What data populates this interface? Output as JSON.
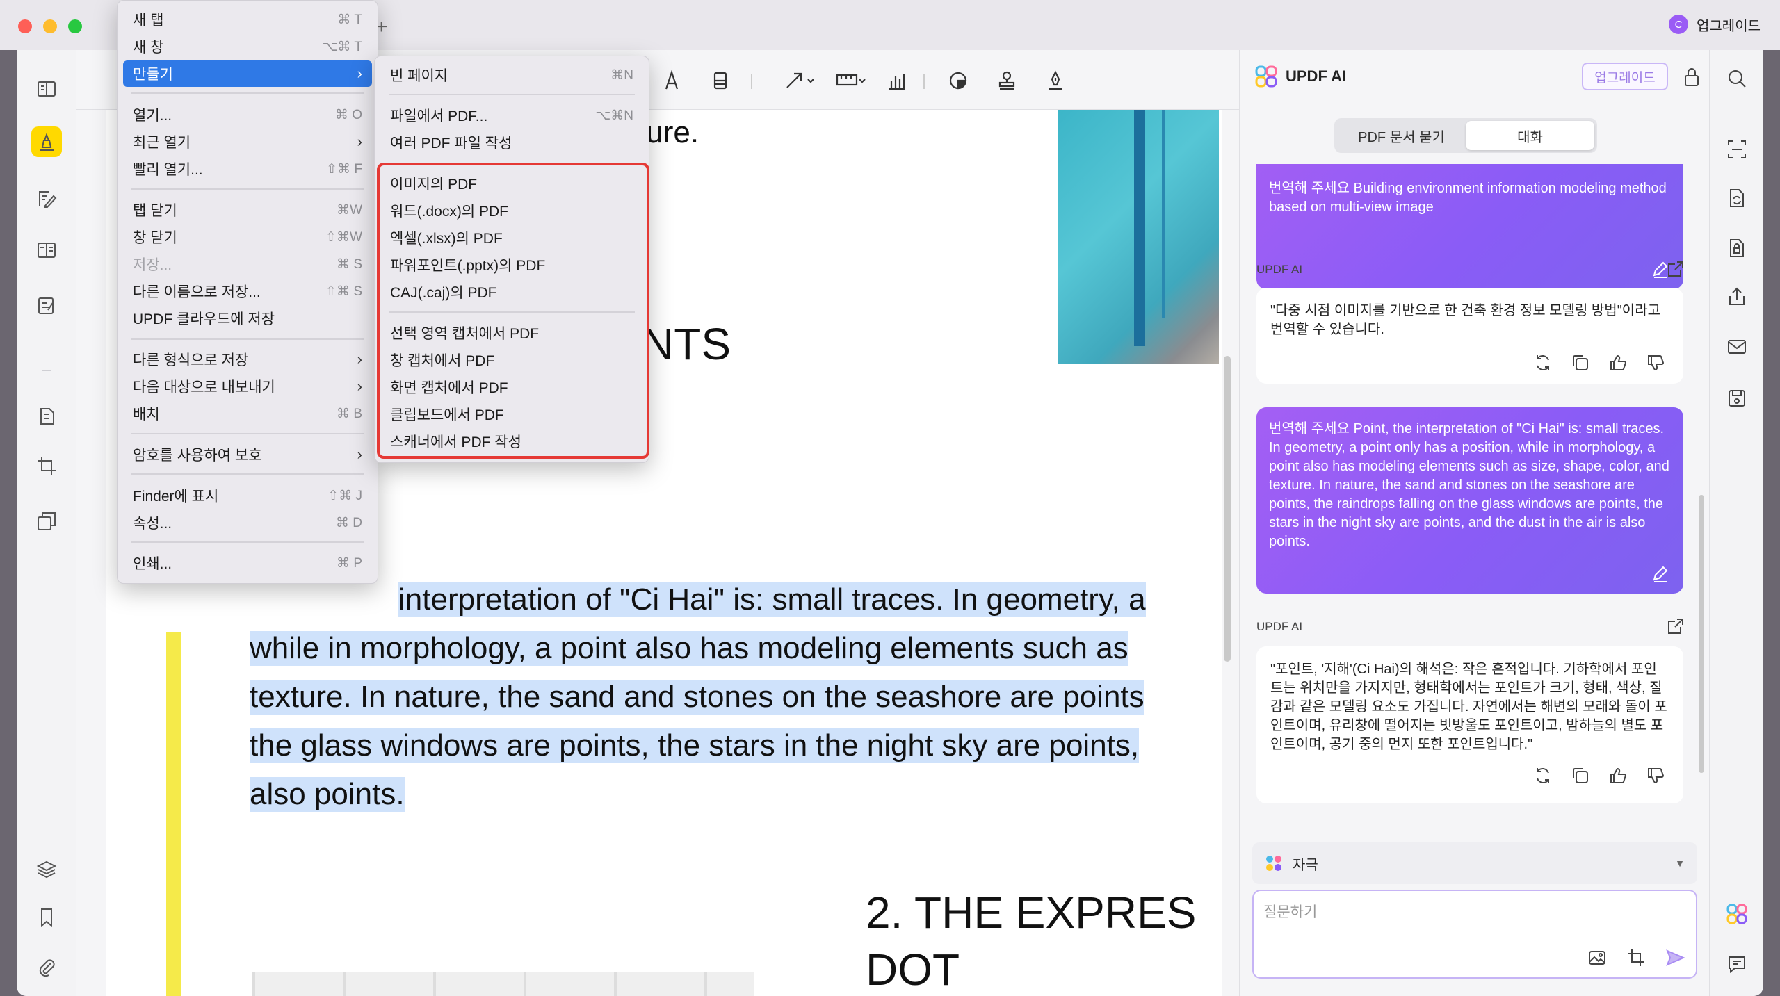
{
  "titlebar": {
    "upgrade_label": "업그레이드",
    "avatar_letter": "C",
    "new_tab_symbol": "+"
  },
  "colors": {
    "accent": "#2f79e6",
    "ai_purple": "#8a5cf6",
    "highlight": "#cfe2fb",
    "annotation_yellow": "#f5ea4a",
    "red_outline": "#e53935"
  },
  "left_sidebar": {
    "icons": [
      "reader-icon",
      "highlighter-icon",
      "edit-pdf-icon",
      "organize-pages-icon",
      "form-icon",
      "compress-icon",
      "crop-icon",
      "batch-icon",
      "layers-icon",
      "bookmark-icon",
      "attachment-icon"
    ]
  },
  "toolbar": {
    "icons": [
      "text-tool-icon",
      "stamp-line-icon",
      "arrow-icon",
      "measure-icon",
      "chart-icon",
      "shape-icon",
      "stamp-icon",
      "signature-icon"
    ]
  },
  "document": {
    "line_ture": "ture.",
    "heading_nts": "NTS",
    "para_lines": [
      "interpretation of \"Ci Hai\" is: small traces. In geometry, a",
      "while in morphology, a point also has modeling elements such as",
      "texture. In nature, the sand and stones on the seashore are points",
      "the glass windows are points, the stars in the night sky are points,",
      "also points."
    ],
    "heading_bottom": "2. THE   EXPRES",
    "heading_bottom_2": "DOT"
  },
  "file_menu": {
    "items": [
      {
        "label": "새 탭",
        "shortcut": "⌘ T"
      },
      {
        "label": "새 창",
        "shortcut": "⌥⌘ T"
      },
      {
        "label": "만들기",
        "submenu": true,
        "highlighted": true
      },
      {
        "label": "열기...",
        "shortcut": "⌘ O"
      },
      {
        "label": "최근 열기",
        "submenu": true
      },
      {
        "label": "빨리 열기...",
        "shortcut": "⇧⌘ F"
      },
      {
        "label": "탭 닫기",
        "shortcut": "⌘W"
      },
      {
        "label": "창 닫기",
        "shortcut": "⇧⌘W"
      },
      {
        "label": "저장...",
        "shortcut": "⌘ S",
        "disabled": true
      },
      {
        "label": "다른 이름으로 저장...",
        "shortcut": "⇧⌘ S"
      },
      {
        "label": "UPDF 클라우드에 저장"
      },
      {
        "label": "다른 형식으로 저장",
        "submenu": true
      },
      {
        "label": "다음 대상으로 내보내기",
        "submenu": true
      },
      {
        "label": "배치",
        "shortcut": "⌘ B"
      },
      {
        "label": "암호를 사용하여 보호",
        "submenu": true
      },
      {
        "label": "Finder에 표시",
        "shortcut": "⇧⌘ J"
      },
      {
        "label": "속성...",
        "shortcut": "⌘ D"
      },
      {
        "label": "인쇄...",
        "shortcut": "⌘ P"
      }
    ],
    "submenu_arrow": "›"
  },
  "create_submenu": {
    "items": [
      {
        "label": "빈 페이지",
        "shortcut": "⌘N"
      },
      {
        "label": "파일에서 PDF...",
        "shortcut": "⌥⌘N"
      },
      {
        "label": "여러 PDF 파일 작성"
      },
      {
        "label": "이미지의 PDF"
      },
      {
        "label": "워드(.docx)의 PDF"
      },
      {
        "label": "엑셀(.xlsx)의 PDF"
      },
      {
        "label": "파워포인트(.pptx)의 PDF"
      },
      {
        "label": "CAJ(.caj)의 PDF"
      },
      {
        "label": "선택 영역 캡처에서 PDF"
      },
      {
        "label": "창 캡처에서 PDF"
      },
      {
        "label": "화면 캡처에서 PDF"
      },
      {
        "label": "클립보드에서 PDF"
      },
      {
        "label": "스캐너에서 PDF 작성"
      }
    ]
  },
  "ai_panel": {
    "title": "UPDF AI",
    "upgrade_button": "업그레이드",
    "tabs": [
      {
        "label": "PDF 문서 묻기",
        "active": false
      },
      {
        "label": "대화",
        "active": true
      }
    ],
    "messages": [
      {
        "role": "user",
        "text": "번역해 주세요  Building environment information modeling method based on multi-view image"
      },
      {
        "role": "ai",
        "label": "UPDF AI",
        "text": "\"다중 시점 이미지를 기반으로 한 건축 환경 정보 모델링 방법\"이라고 번역할 수 있습니다."
      },
      {
        "role": "user",
        "text": "번역해 주세요  Point, the interpretation of \"Ci Hai\" is: small traces. In geometry, a point only has a position, while in morphology, a point also has modeling elements such as size, shape, color, and texture. In nature, the sand and stones on the seashore are points, the raindrops falling on the glass windows are points, the stars in the night sky are points, and the dust in the air is also points."
      },
      {
        "role": "ai",
        "label": "UPDF AI",
        "text": "\"포인트, '지해'(Ci Hai)의 해석은: 작은 흔적입니다. 기하학에서 포인트는 위치만을 가지지만, 형태학에서는 포인트가 크기, 형태, 색상, 질감과 같은 모델링 요소도 가집니다. 자연에서는 해변의 모래와 돌이 포인트이며, 유리창에 떨어지는 빗방울도 포인트이고, 밤하늘의 별도 포인트이며, 공기 중의 먼지 또한 포인트입니다.\""
      }
    ],
    "model_label": "자극",
    "input_placeholder": "질문하기"
  },
  "right_sidebar": {
    "icons": [
      "search-icon",
      "ocr-icon",
      "convert-icon",
      "protect-icon",
      "share-icon",
      "email-icon",
      "save-icon",
      "updf-ai-icon",
      "comment-icon"
    ]
  }
}
